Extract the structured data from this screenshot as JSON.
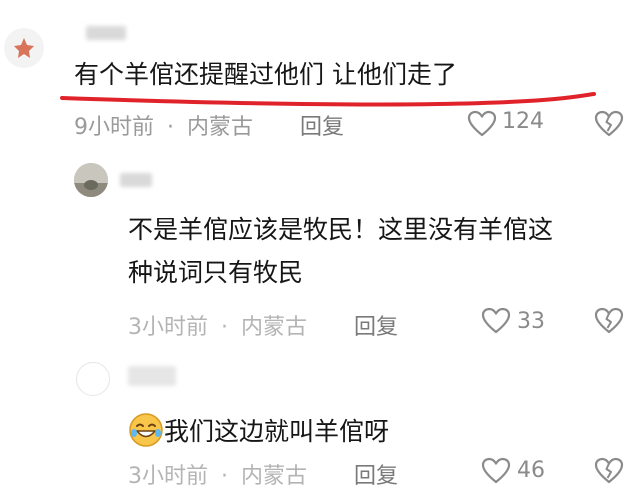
{
  "comments": [
    {
      "text": "有个羊倌还提醒过他们 让他们走了",
      "time": "9小时前",
      "dot": "·",
      "location": "内蒙古",
      "reply_label": "回复",
      "likes": "124"
    },
    {
      "text_line1": "不是羊倌应该是牧民！这里没有羊倌这",
      "text_line2": "种说词只有牧民",
      "time": "3小时前",
      "dot": "·",
      "location": "内蒙古",
      "reply_label": "回复",
      "likes": "33"
    },
    {
      "emoji": "😂",
      "text": "我们这边就叫羊倌呀",
      "time": "3小时前",
      "dot": "·",
      "location": "内蒙古",
      "reply_label": "回复",
      "likes": "46"
    }
  ],
  "colors": {
    "underline": "#e0232b",
    "text": "#161616",
    "meta": "#9a9a9a"
  },
  "icons": [
    "heart-icon",
    "broken-heart-icon"
  ]
}
